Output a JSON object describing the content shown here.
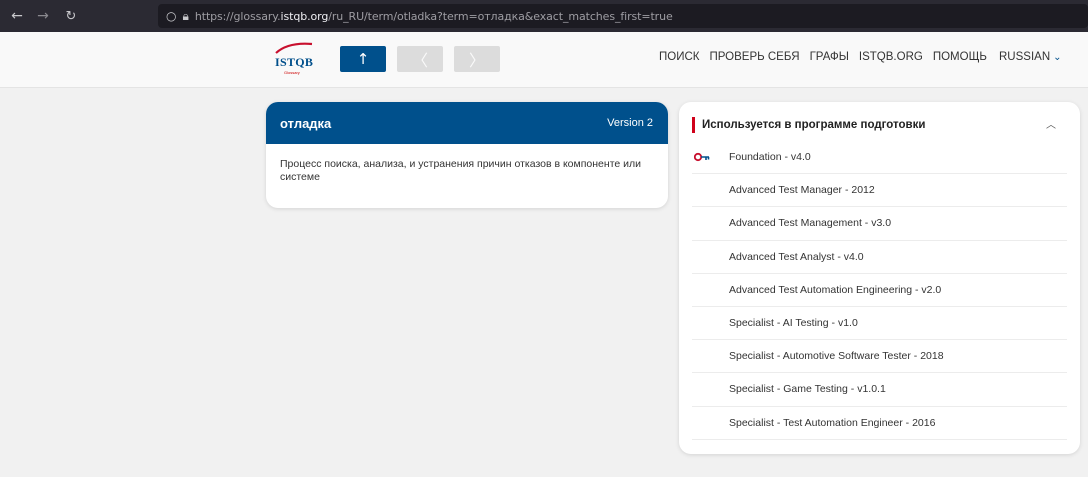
{
  "browser": {
    "url_scheme": "https://glossary.",
    "url_domain": "istqb.org",
    "url_rest": "/ru_RU/term/otladka?term=отладка&exact_matches_first=true"
  },
  "header": {
    "logo_text": "ISTQB",
    "logo_sub": "Glossary",
    "nav": [
      "ПОИСК",
      "ПРОВЕРЬ СЕБЯ",
      "ГРАФЫ",
      "ISTQB.ORG",
      "ПОМОЩЬ"
    ],
    "language": "RUSSIAN"
  },
  "term": {
    "title": "отладка",
    "version": "Version 2",
    "definition": "Процесс поиска, анализа, и устранения причин отказов в компоненте или системе"
  },
  "syllabus": {
    "title": "Используется в программе подготовки",
    "items": [
      "Foundation - v4.0",
      "Advanced Test Manager - 2012",
      "Advanced Test Management - v3.0",
      "Advanced Test Analyst - v4.0",
      "Advanced Test Automation Engineering - v2.0",
      "Specialist - AI Testing - v1.0",
      "Specialist - Automotive Software Tester - 2018",
      "Specialist - Game Testing - v1.0.1",
      "Specialist - Test Automation Engineer - 2016"
    ]
  },
  "colors": {
    "primary": "#00508c",
    "accent": "#d0021b",
    "background": "#f1f1f1"
  },
  "icons": {
    "back": "arrow-left-icon",
    "forward": "arrow-right-icon",
    "reload": "reload-icon",
    "up": "arrow-up-icon",
    "prev": "chevron-left-icon",
    "next": "chevron-right-icon",
    "key": "key-icon"
  }
}
